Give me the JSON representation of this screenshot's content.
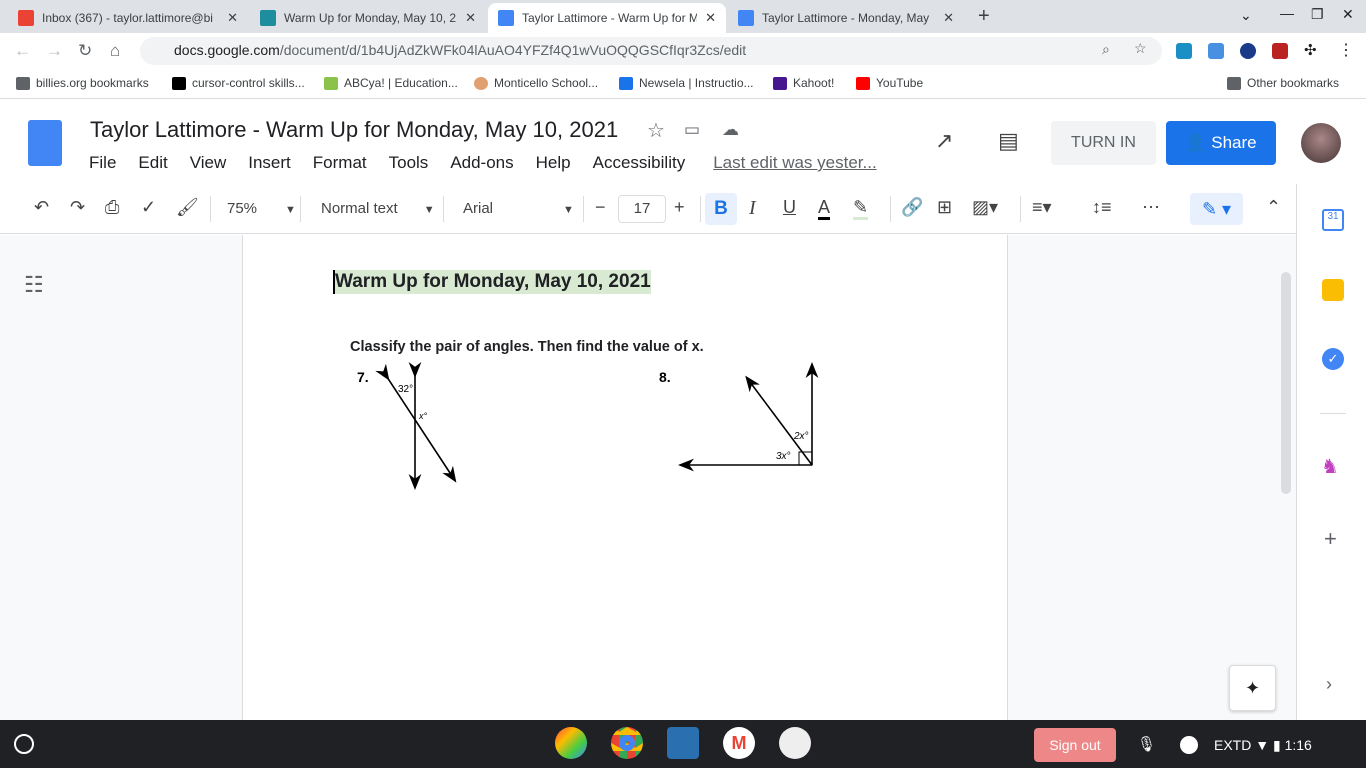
{
  "browser": {
    "tabs": [
      {
        "label": "Inbox (367) - taylor.lattimore@bi",
        "icon": "gmail-icon",
        "color": "#ea4335"
      },
      {
        "label": "Warm Up for Monday, May 10, 2",
        "icon": "classroom-icon",
        "color": "#1e8e9e"
      },
      {
        "label": "Taylor Lattimore - Warm Up for M",
        "icon": "docs-icon",
        "color": "#4285f4",
        "active": true
      },
      {
        "label": "Taylor Lattimore - Monday, May",
        "icon": "docs-icon",
        "color": "#4285f4"
      }
    ],
    "url_domain": "docs.google.com",
    "url_path": "/document/d/1b4UjAdZkWFk04lAuAO4YFZf4Q1wVuOQQGSCfIqr3Zcs/edit",
    "bookmarks": [
      {
        "label": "billies.org bookmarks",
        "color": "#5f6368"
      },
      {
        "label": "cursor-control skills...",
        "color": "#000"
      },
      {
        "label": "ABCya! | Education...",
        "color": "#8bc34a"
      },
      {
        "label": "Monticello School...",
        "color": "#e0a070"
      },
      {
        "label": "Newsela | Instructio...",
        "color": "#1a73e8"
      },
      {
        "label": "Kahoot!",
        "color": "#46178f"
      },
      {
        "label": "YouTube",
        "color": "#ff0000"
      }
    ],
    "other_bookmarks": "Other bookmarks"
  },
  "doc": {
    "title": "Taylor Lattimore - Warm Up for Monday, May 10, 2021",
    "menus": [
      "File",
      "Edit",
      "View",
      "Insert",
      "Format",
      "Tools",
      "Add-ons",
      "Help",
      "Accessibility"
    ],
    "last_edit": "Last edit was yester...",
    "turn_in": "TURN IN",
    "share": "Share"
  },
  "toolbar": {
    "zoom": "75%",
    "style": "Normal text",
    "font": "Arial",
    "font_size": "17"
  },
  "content": {
    "heading": "Warm Up for Monday, May 10, 2021",
    "instruction": "Classify the pair of angles. Then find the value of x.",
    "problems": [
      {
        "number": "7.",
        "labels": [
          "32°",
          "x°"
        ]
      },
      {
        "number": "8.",
        "labels": [
          "2x°",
          "3x°"
        ]
      }
    ]
  },
  "shelf": {
    "sign_out": "Sign out",
    "ime": "EXTD",
    "time": "1:16"
  }
}
